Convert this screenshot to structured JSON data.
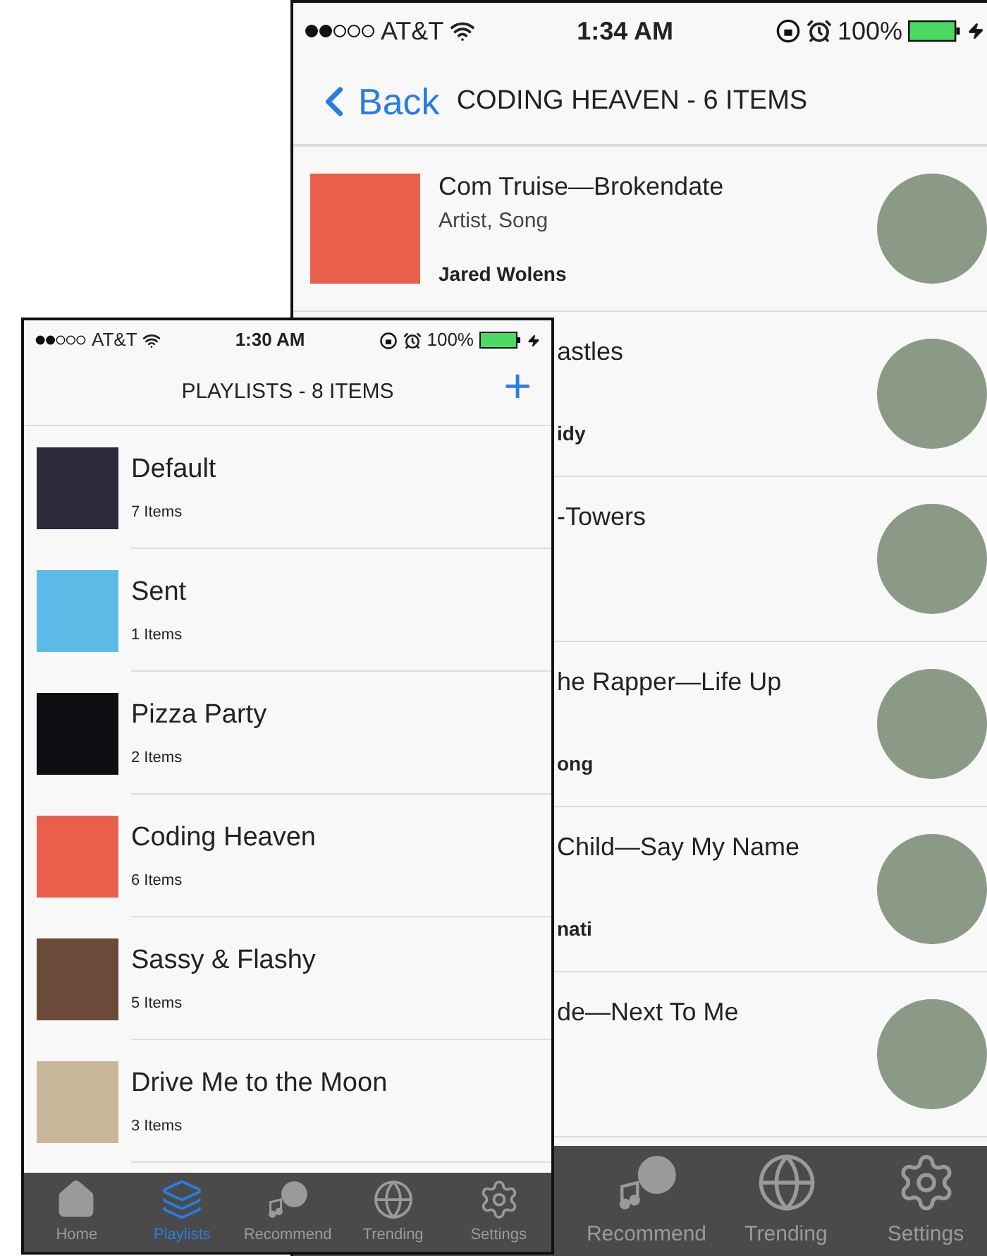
{
  "back_phone": {
    "status_bar": {
      "carrier": "AT&T",
      "time": "1:34 AM",
      "battery": "100%"
    },
    "nav": {
      "back": "Back",
      "title": "CODING HEAVEN - 6 ITEMS"
    },
    "songs": [
      {
        "kind": "full",
        "title": "Com Truise—Brokendate",
        "subtitle": "Artist, Song",
        "user": "Jared Wolens",
        "color": "#e8604c"
      },
      {
        "kind": "clipped",
        "title": "astles",
        "user": "idy"
      },
      {
        "kind": "clipped",
        "title": "-Towers"
      },
      {
        "kind": "clipped",
        "title": "he Rapper—Life Up",
        "user": "ong"
      },
      {
        "kind": "clipped",
        "title": "Child—Say My Name",
        "user": "nati"
      },
      {
        "kind": "clipped",
        "title": "de—Next To Me"
      }
    ],
    "tabs": [
      {
        "kind": "recommend",
        "label": "Recommend",
        "selected": false
      },
      {
        "kind": "trending",
        "label": "Trending",
        "selected": false
      },
      {
        "kind": "settings",
        "label": "Settings",
        "selected": false
      }
    ]
  },
  "front_phone": {
    "status_bar": {
      "carrier": "AT&T",
      "time": "1:30 AM",
      "battery": "100%"
    },
    "nav": {
      "title": "PLAYLISTS - 8 ITEMS",
      "add": "+"
    },
    "playlists": [
      {
        "name": "Default",
        "count": "7 Items",
        "color": "#2b2a3a"
      },
      {
        "name": "Sent",
        "count": "1 Items",
        "color": "#5bbbe6"
      },
      {
        "name": "Pizza Party",
        "count": "2 Items",
        "color": "#0d0d12"
      },
      {
        "name": "Coding Heaven",
        "count": "6 Items",
        "color": "#e8604c"
      },
      {
        "name": "Sassy & Flashy",
        "count": "5 Items",
        "color": "#6b4a3a"
      },
      {
        "name": "Drive Me to the Moon",
        "count": "3 Items",
        "color": "#c9b79a"
      }
    ],
    "tabs": [
      {
        "kind": "home",
        "label": "Home",
        "selected": false
      },
      {
        "kind": "playlists",
        "label": "Playlists",
        "selected": true
      },
      {
        "kind": "recommend",
        "label": "Recommend",
        "selected": false
      },
      {
        "kind": "trending",
        "label": "Trending",
        "selected": false
      },
      {
        "kind": "settings",
        "label": "Settings",
        "selected": false
      }
    ]
  }
}
